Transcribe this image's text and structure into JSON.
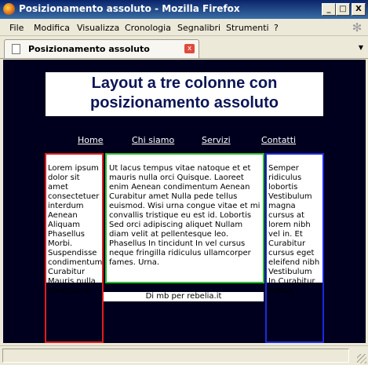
{
  "window": {
    "title": "Posizionamento assoluto - Mozilla Firefox",
    "controls": {
      "minimize": "_",
      "maximize": "□",
      "close": "X"
    }
  },
  "menu": {
    "items": [
      "File",
      "Modifica",
      "Visualizza",
      "Cronologia",
      "Segnalibri",
      "Strumenti",
      "?"
    ]
  },
  "tab": {
    "label": "Posizionamento assoluto",
    "close_glyph": "x",
    "list_glyph": "▼"
  },
  "page": {
    "title": "Layout a tre colonne con posizionamento assoluto",
    "nav": [
      "Home",
      "Chi siamo",
      "Servizi",
      "Contatti"
    ],
    "left_text": "Lorem ipsum dolor sit amet consectetuer interdum Aenean Aliquam Phasellus Morbi. Suspendisse condimentum Curabitur Mauris nulla Vivamus a",
    "center_text": "Ut lacus tempus vitae natoque et et mauris nulla orci Quisque. Laoreet enim Aenean condimentum Aenean Curabitur amet Nulla pede tellus euismod. Wisi urna congue vitae et mi convallis tristique eu est id. Lobortis Sed orci adipiscing aliquet Nullam diam velit at pellentesque leo. Phasellus In tincidunt In vel cursus neque fringilla ridiculus ullamcorper fames. Urna.",
    "right_text": "Semper ridiculus lobortis Vestibulum magna cursus at lorem nibh vel in. Et Curabitur cursus eget eleifend nibh Vestibulum In Curabitur metus",
    "footer": "Di mb per rebelia.it"
  },
  "colors": {
    "background": "#00001e",
    "left_border": "#e31b1b",
    "center_border": "#27c12b",
    "right_border": "#1b29e3",
    "title_color": "#0b1556"
  }
}
